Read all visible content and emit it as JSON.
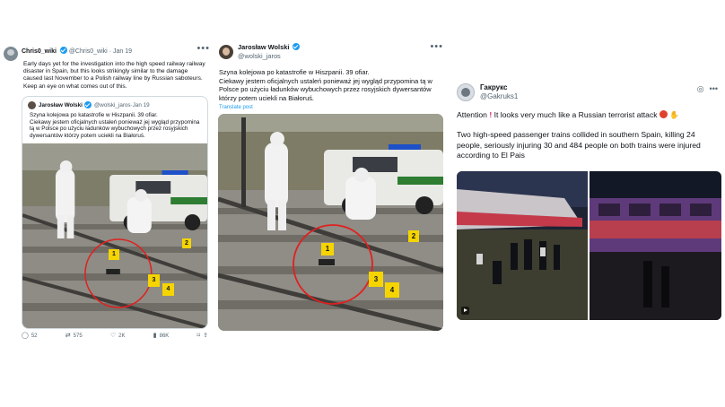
{
  "tweet1": {
    "author_name": "Chris0_wiki",
    "author_handle": "@Chris0_wiki",
    "date": "Jan 19",
    "text": "Early days yet for the investigation into the high speed railway railway disaster in Spain, but this looks strikingly similar to the damage caused last November to a Polish railway line by Russian saboteurs. Keep an eye on what comes out of this.",
    "quote": {
      "author_name": "Jarosław Wolski",
      "author_handle": "@wolski_jaros",
      "date": "Jan 19",
      "text": "Szyna kolejowa po katastrofie w Hiszpanii. 39 ofiar.\nCiekawy jestem oficjalnych ustaleń ponieważ jej wygląd przypomina tą w Polsce po użyciu ładunków wybuchowych przez rosyjskich dywersantów którzy potem uciekli na Białoruś."
    },
    "stats": {
      "replies": "52",
      "reposts": "575",
      "likes": "2K",
      "views": "86K"
    },
    "evidence_markers": [
      "1",
      "2",
      "3",
      "4"
    ]
  },
  "tweet2": {
    "author_name": "Jarosław Wolski",
    "author_handle": "@wolski_jaros",
    "text": "Szyna kolejowa po katastrofie w Hiszpanii. 39 ofiar.\nCiekawy jestem oficjalnych ustaleń ponieważ jej wygląd przypomina tą w Polsce po użyciu ładunków wybuchowych przez rosyjskich dywersantów którzy potem uciekli na Białoruś.",
    "translate_label": "Translate post",
    "evidence_markers": [
      "1",
      "2",
      "3",
      "4"
    ]
  },
  "tweet3": {
    "author_name": "Гакрукс",
    "author_handle": "@Gakruks1",
    "text_line1": "Attention",
    "text_line1_rest": " It looks very much like a Russian terrorist attack ",
    "text_paragraph2": "Two high-speed passenger trains collided in southern Spain, killing 24 people, seriously injuring 30 and 484 people on both trains were injured according to El Pais"
  },
  "icons": {
    "more": "more-horizontal-icon",
    "reply": "reply-icon",
    "repost": "repost-icon",
    "like": "heart-icon",
    "views": "views-bar-icon",
    "bookmark": "bookmark-icon",
    "share": "share-icon",
    "grok": "grok-icon",
    "verified": "verified-badge-icon"
  },
  "colors": {
    "accent": "#1d9bf0",
    "text": "#0f1419",
    "muted": "#536471",
    "marker": "#f5d400",
    "red_circle": "#e02020"
  }
}
